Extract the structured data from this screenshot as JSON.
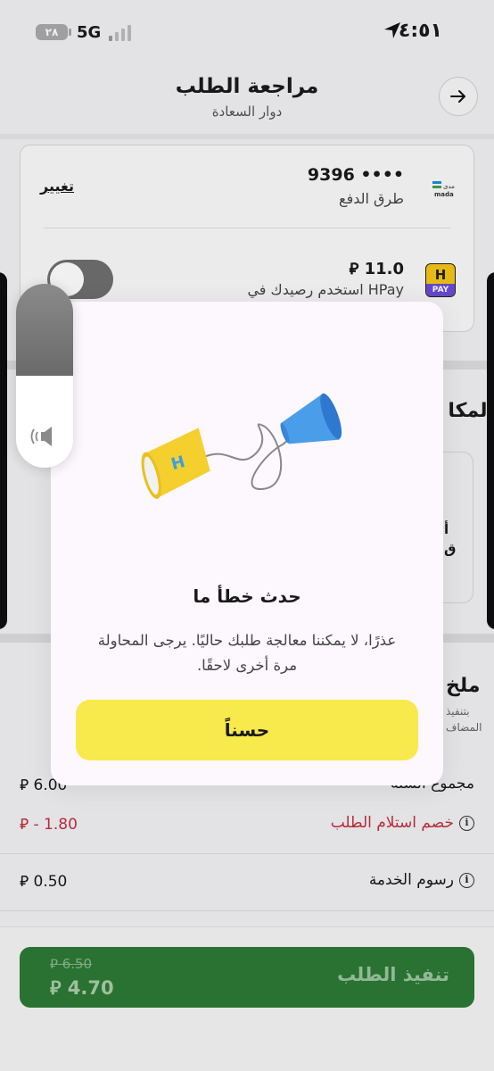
{
  "status_bar": {
    "time": "٤:٥١",
    "network": "5G",
    "battery": "٢٨",
    "icons": [
      "location-arrow-icon",
      "signal-bars-icon",
      "battery-icon"
    ]
  },
  "header": {
    "title": "مراجعة الطلب",
    "subtitle": "دوار السعادة",
    "back_icon": "arrow-right-icon"
  },
  "payment": {
    "card_number": "9396 ••••",
    "label": "طرق الدفع",
    "change_label": "تغيير",
    "logo": "mada-logo"
  },
  "hpay": {
    "amount": "11.0",
    "currency_symbol": "⃁",
    "label": "استخدم رصيدك في HPay",
    "logo_h": "H",
    "logo_pay": "PAY",
    "toggle_on": false
  },
  "background": {
    "place_title": "المكا",
    "place_text1": "أ",
    "place_text2": "ق",
    "notes_title": "ملخ",
    "notes_sub1": "بتنفيذ",
    "notes_sub2": "المضاف"
  },
  "summary": {
    "rows": [
      {
        "label": "مجموع السلة",
        "value": "6.00"
      },
      {
        "label": "خصم استلام الطلب",
        "value": "- 1.80",
        "color": "#c03040"
      },
      {
        "label": "رسوم الخدمة",
        "value": "0.50"
      }
    ]
  },
  "checkout": {
    "label": "تنفيذ الطلب",
    "old_price": "6.50",
    "new_price": "4.70",
    "color": "#2c7a35"
  },
  "modal": {
    "title": "حدث خطأ ما",
    "message": "عذرًا، لا يمكننا معالجة طلبك حاليًا. يرجى المحاولة مرة أخرى لاحقًا.",
    "ok_label": "حسناً",
    "button_color": "#f8e94c",
    "illustration": "tin-can-phone-illustration"
  },
  "volume_hud": {
    "level": 0.5,
    "icon": "speaker-icon"
  }
}
